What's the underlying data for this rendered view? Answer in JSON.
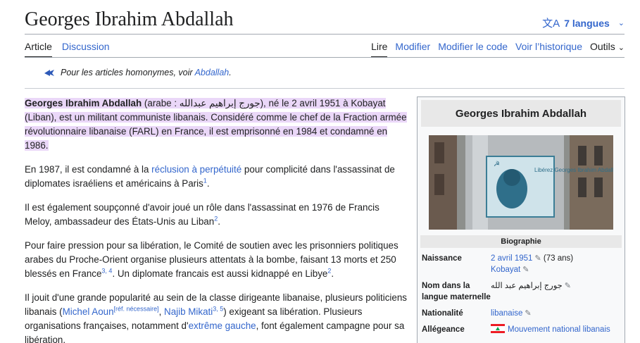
{
  "header": {
    "title": "Georges Ibrahim Abdallah",
    "languages_label": "7 langues"
  },
  "tabs": {
    "left": [
      "Article",
      "Discussion"
    ],
    "right": [
      "Lire",
      "Modifier",
      "Modifier le code",
      "Voir l’historique",
      "Outils"
    ]
  },
  "hatnote": {
    "text": "Pour les articles homonymes, voir ",
    "link": "Abdallah",
    "end": "."
  },
  "article": {
    "p1": {
      "name": "Georges Ibrahim Abdallah",
      "paren_open": " (arabe : ",
      "arabic": "جورج إبراهيم عبدالله",
      "rest": "), né le 2 avril 1951 à Kobayat (Liban), est un militant communiste libanais. Considéré comme le chef de la Fraction armée révolutionnaire libanaise (FARL) en France, il est emprisonné en 1984 et condamné en 1986."
    },
    "p2": {
      "a": "En 1987, il est condamné à la ",
      "link": "réclusion à perpétuité",
      "b": " pour complicité dans l'assassinat de diplomates israéliens et américains à Paris",
      "sup": "1",
      "c": "."
    },
    "p3": {
      "a": "Il est également soupçonné d'avoir joué un rôle dans l'assassinat en 1976 de Francis Meloy, ambassadeur des États-Unis au Liban",
      "sup": "2",
      "c": "."
    },
    "p4": {
      "a": "Pour faire pression pour sa libération, le Comité de soutien avec les prisonniers politiques arabes du Proche-Orient organise plusieurs attentats à la bombe, faisant 13 morts et 250 blessés en France",
      "sup1": "3, 4",
      "b": ". Un diplomate francais est aussi kidnappé en Libye",
      "sup2": "2",
      "c": "."
    },
    "p5": {
      "a": "Il jouit d'une grande popularité au sein de la classe dirigeante libanaise, plusieurs politiciens libanais (",
      "link1": "Michel Aoun",
      "sup1": "[réf. nécessaire]",
      "sep": ", ",
      "link2": "Najib Mikati",
      "sup2": "3, 5",
      "b": ") exigeant sa libération. Plusieurs organisations françaises, notamment d'",
      "link3": "extrême gauche",
      "c": ", font également campagne pour sa libération."
    }
  },
  "infobox": {
    "title": "Georges Ibrahim Abdallah",
    "section": "Biographie",
    "sticker_text": "Libérez Georges Ibrahim Abdallah",
    "rows": [
      {
        "label": "Naissance",
        "value_link": "2 avril 1951",
        "value_extra": " (73 ans)",
        "line2_link": "Kobayat"
      },
      {
        "label": "Nom dans la langue maternelle",
        "value": "جورج إبراهيم عبد الله"
      },
      {
        "label": "Nationalité",
        "value_link": "libanaise"
      },
      {
        "label": "Allégeance",
        "value_link": "Mouvement national libanais"
      }
    ]
  },
  "icons": {
    "translate": "translate-icon",
    "chevron": "chevron-down-icon",
    "pencil": "pencil-icon",
    "disambiguation": "disambiguation-icon"
  }
}
